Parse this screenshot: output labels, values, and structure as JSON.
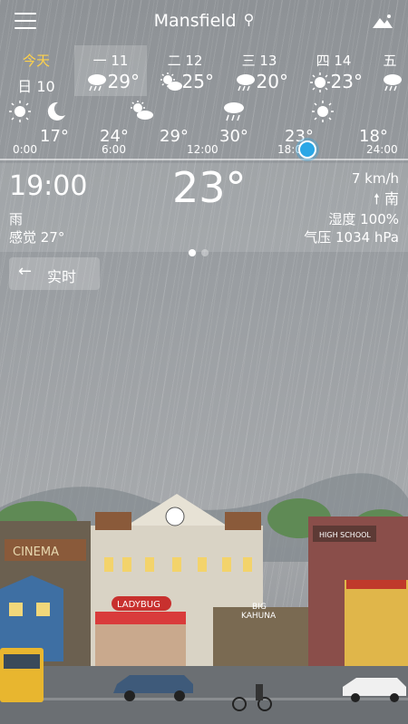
{
  "header": {
    "city": "Mansfield",
    "icons": [
      "menu-icon",
      "search-icon",
      "mountain-icon"
    ]
  },
  "days": [
    {
      "name": "今天",
      "date": "日 10",
      "icon": "",
      "temp": ""
    },
    {
      "name": "一 11",
      "icon": "rain-cloud-icon",
      "temp": "29°"
    },
    {
      "name": "二 12",
      "icon": "sun-cloud-icon",
      "temp": "25°"
    },
    {
      "name": "三 13",
      "icon": "rain-cloud-icon",
      "temp": "20°"
    },
    {
      "name": "四 14",
      "icon": "sun-icon",
      "temp": "23°"
    },
    {
      "name": "五",
      "icon": "rain-cloud-icon",
      "temp": ""
    }
  ],
  "hourly": {
    "temps": [
      "17°",
      "24°",
      "29°",
      "30°",
      "23°",
      "18°"
    ],
    "icons": [
      "sun-icon",
      "moon-icon",
      "sun-cloud-icon",
      "rain-cloud-icon",
      "sun-icon"
    ],
    "times": [
      "0:00",
      "6:00",
      "12:00",
      "18:00",
      "24:00"
    ]
  },
  "current": {
    "time": "19:00",
    "temp": "23°",
    "wind_speed": "7 km/h",
    "wind_dir": "南",
    "condition": "雨",
    "feels": "感觉 27°",
    "humidity": "湿度 100%",
    "pressure": "气压 1034 hPa"
  },
  "realtime_button": {
    "label": "实时"
  },
  "colors": {
    "accent": "#2aa7e6",
    "today": "#ffd24a"
  }
}
